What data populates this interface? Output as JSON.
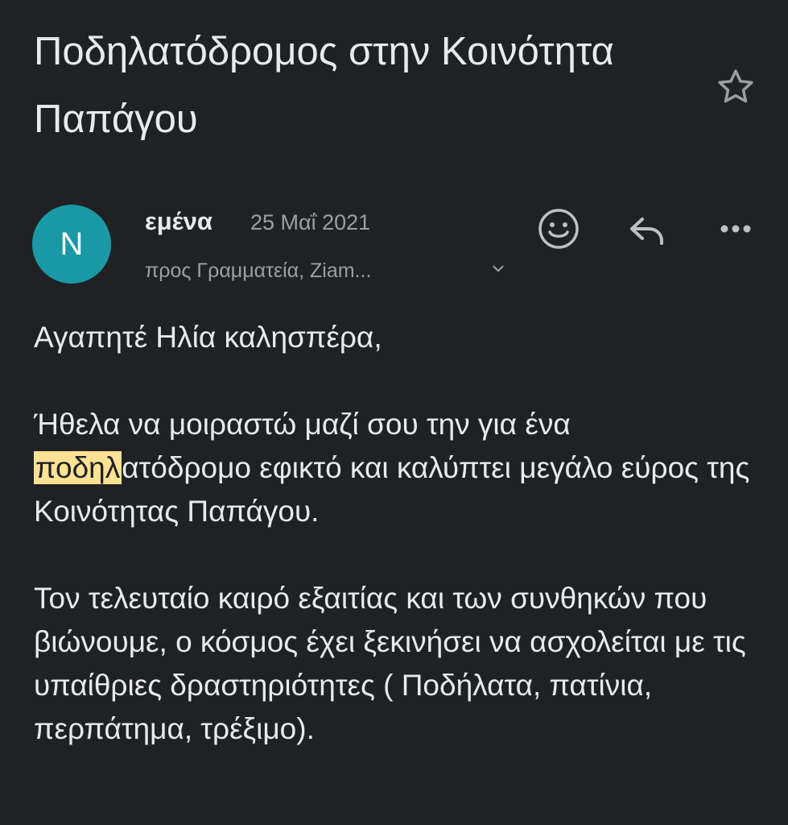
{
  "email": {
    "subject": "Ποδηλατόδρομος στην Κοινότητα Παπάγου",
    "sender": {
      "initial": "N",
      "name": "εμένα",
      "avatar_color": "#1a98a5"
    },
    "date": "25 Μαΐ 2021",
    "recipients": "προς Γραμματεία, Ziam...",
    "actions": {
      "star_icon": "star-outline-icon",
      "reaction_icon": "emoji-smile-icon",
      "reply_icon": "reply-icon",
      "more_icon": "more-horizontal-icon",
      "expand_icon": "chevron-down-icon"
    },
    "body": {
      "greeting": "Αγαπητέ Ηλία καλησπέρα,",
      "p1_before": "Ήθελα να μοιραστώ μαζί σου την για ένα ",
      "p1_highlight": "ποδηλ",
      "p1_after": "ατόδρομο εφικτό και καλύπτει μεγάλο εύρος της Κοινότητας Παπάγου.",
      "p2": "Τον τελευταίο καιρό εξαιτίας και των συνθηκών που βιώνουμε, ο κόσμος έχει ξεκινήσει να ασχολείται με τις υπαίθριες δραστηριότητες ( Ποδήλατα, πατίνια, περπάτημα, τρέξιμο)."
    },
    "highlight_color": "#fde293"
  }
}
